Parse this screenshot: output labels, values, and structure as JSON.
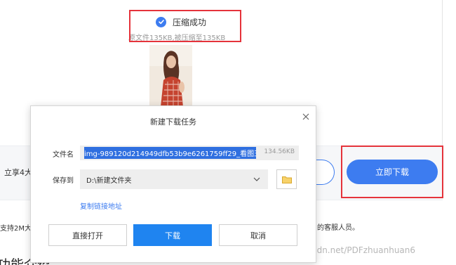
{
  "compress": {
    "status": "压缩成功",
    "info": "原文件135KB,被压缩至135KB"
  },
  "band": {
    "left_text": "立享4大",
    "download_now": "立即下载"
  },
  "bottom": {
    "left_text": "支持2M大",
    "right_text": "的客服人员。",
    "heading_fragment": "功能介绍",
    "watermark": "https://blog.csdn.net/PDFzhuanhuan6"
  },
  "dialog": {
    "title": "新建下载任务",
    "filename_label": "文件名",
    "filename": "img-989120d214949dfb53b9e6261759ff29_看图王",
    "filesize": "134.56KB",
    "saveto_label": "保存到",
    "path": "D:\\新建文件夹",
    "copy_link": "复制链接地址",
    "btn_open": "直接打开",
    "btn_download": "下载",
    "btn_cancel": "取消"
  },
  "colors": {
    "accent": "#3d7cf0",
    "highlight": "#e5333b"
  },
  "icons": [
    "check-circle-icon",
    "close-icon",
    "chevron-down-icon",
    "folder-icon"
  ]
}
